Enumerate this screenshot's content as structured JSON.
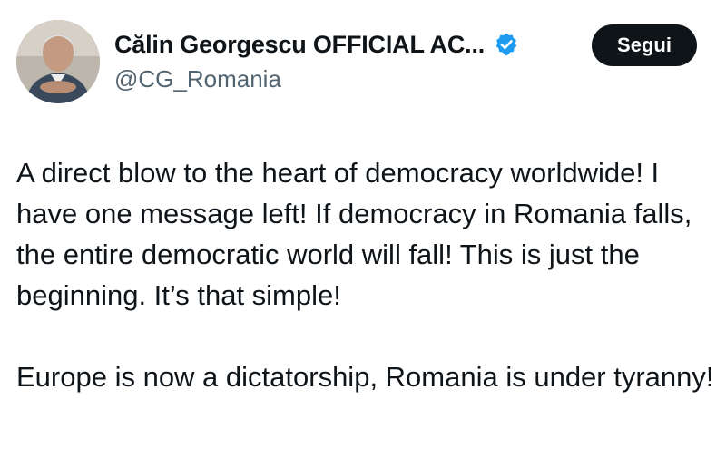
{
  "author": {
    "display_name": "Călin Georgescu OFFICIAL AC...",
    "handle": "@CG_Romania",
    "verified_icon": "verified-badge-icon",
    "verified_color": "#1d9bf0"
  },
  "follow_button": {
    "label": "Segui"
  },
  "tweet": {
    "paragraphs": [
      "A direct blow to the heart of democracy worldwide! I have one message left! If democracy in Romania falls, the entire democratic world will fall! This is just the beginning. It’s that simple!",
      "Europe is now a dictatorship, Romania is under tyranny!"
    ]
  }
}
